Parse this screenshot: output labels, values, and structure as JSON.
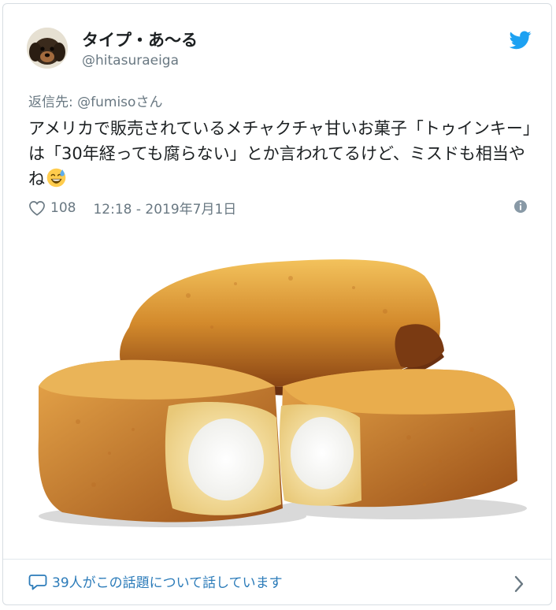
{
  "tweet": {
    "display_name": "タイプ・あ〜る",
    "handle": "@hitasuraeiga",
    "reply_prefix": "返信先: ",
    "reply_to": "@fumiso",
    "reply_suffix": "さん",
    "text": "アメリカで販売されているメチャクチャ甘いお菓子「トゥインキー」は「30年経っても腐らない」とか言われてるけど、ミスドも相当やね",
    "emoji": "sweat-smile-emoji",
    "like_count": "108",
    "timestamp": "12:18 - 2019年7月1日",
    "media_icon": "snack-cakes-photo"
  },
  "footer": {
    "conversation_text": "39人がこの話題について話しています"
  },
  "colors": {
    "brand_blue": "#1da1f2",
    "link_blue": "#2b7bb9",
    "muted_gray": "#697882",
    "text": "#1c2022"
  },
  "icons": {
    "brand": "twitter-bird-icon",
    "like": "heart-icon",
    "info": "info-icon",
    "conversation": "speech-bubble-icon",
    "more": "chevron-right-icon"
  }
}
